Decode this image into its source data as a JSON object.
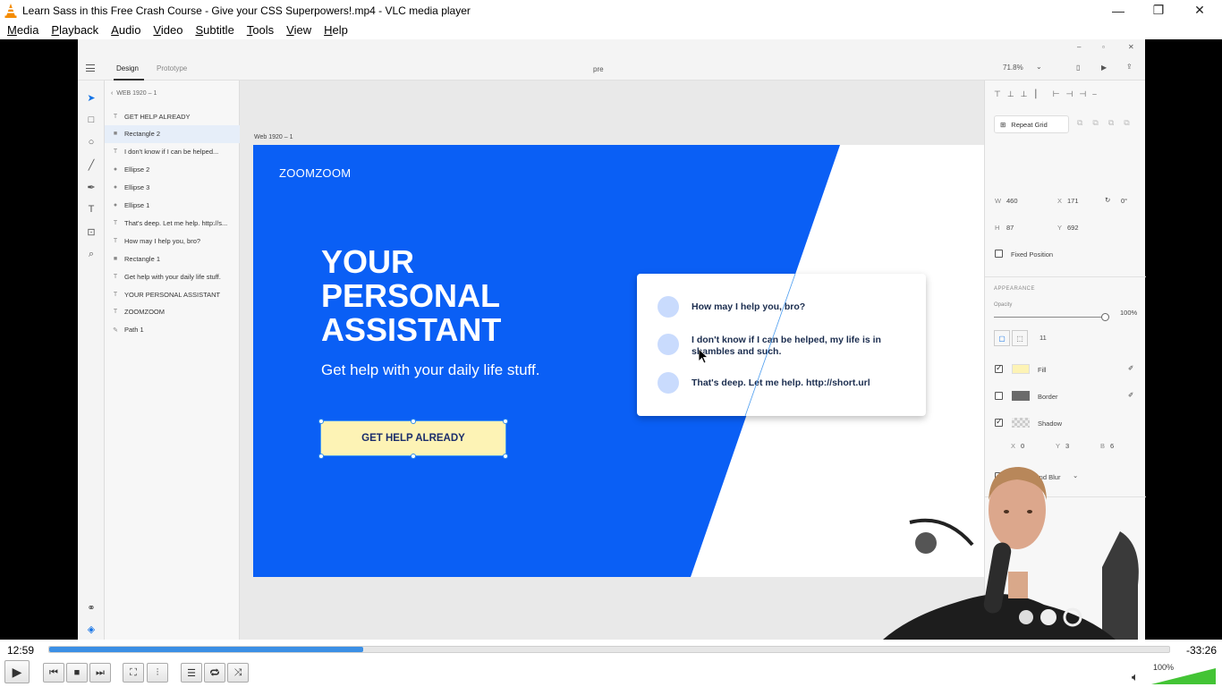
{
  "window": {
    "title": "Learn Sass in this Free Crash Course - Give your CSS Superpowers!.mp4 - VLC media player",
    "minimize_glyph": "—",
    "restore_glyph": "❐",
    "close_glyph": "✕"
  },
  "menu": [
    "Media",
    "Playback",
    "Audio",
    "Video",
    "Subtitle",
    "Tools",
    "View",
    "Help"
  ],
  "xd": {
    "tabs": {
      "design": "Design",
      "prototype": "Prototype"
    },
    "doc_name": "pre",
    "zoom": "71.8%",
    "breadcrumb": "WEB 1920 – 1",
    "artboard_label": "Web 1920 – 1",
    "layers": [
      {
        "icon": "T",
        "label": "GET HELP ALREADY",
        "selected": false
      },
      {
        "icon": "■",
        "label": "Rectangle 2",
        "selected": true
      },
      {
        "icon": "T",
        "label": "I don't know if I can be helped...",
        "selected": false
      },
      {
        "icon": "●",
        "label": "Ellipse 2",
        "selected": false
      },
      {
        "icon": "●",
        "label": "Ellipse 3",
        "selected": false
      },
      {
        "icon": "●",
        "label": "Ellipse 1",
        "selected": false
      },
      {
        "icon": "T",
        "label": "That's deep. Let me help. http://s...",
        "selected": false
      },
      {
        "icon": "T",
        "label": "How may I help you, bro?",
        "selected": false
      },
      {
        "icon": "■",
        "label": "Rectangle 1",
        "selected": false
      },
      {
        "icon": "T",
        "label": "Get help with your daily life stuff.",
        "selected": false
      },
      {
        "icon": "T",
        "label": "YOUR  PERSONAL ASSISTANT",
        "selected": false
      },
      {
        "icon": "T",
        "label": "ZOOMZOOM",
        "selected": false
      },
      {
        "icon": "✎",
        "label": "Path 1",
        "selected": false
      }
    ],
    "design": {
      "brand": "ZOOMZOOM",
      "headline_1": "YOUR",
      "headline_2": "PERSONAL",
      "headline_3": "ASSISTANT",
      "subhead": "Get help with your daily life stuff.",
      "cta": "GET HELP ALREADY",
      "chat": [
        "How may I help you, bro?",
        "I don't know if I can be helped, my life is in shambles and such.",
        "That's deep. Let me help. http://short.url"
      ],
      "blue": "#0a5ff5",
      "cta_bg": "#fdf3b5",
      "cta_text": "#1b2d6b"
    },
    "props": {
      "repeat_grid": "Repeat Grid",
      "w_label": "W",
      "w": "460",
      "x_label": "X",
      "x": "171",
      "rotation": "0°",
      "h_label": "H",
      "h": "87",
      "y_label": "Y",
      "y": "692",
      "fixed_position": "Fixed Position",
      "appearance": "APPEARANCE",
      "opacity_label": "Opacity",
      "opacity": "100%",
      "radius": "11",
      "fill": "Fill",
      "border": "Border",
      "shadow": "Shadow",
      "shadow_x_label": "X",
      "shadow_x": "0",
      "shadow_y_label": "Y",
      "shadow_y": "3",
      "shadow_b_label": "B",
      "shadow_b": "6",
      "background_blur": "Background Blur",
      "fill_color": "#fdf3b5",
      "border_color": "#6b6b6b"
    }
  },
  "player": {
    "elapsed": "12:59",
    "remaining": "-33:26",
    "progress": 0.28,
    "volume_text": "100%",
    "volume": 1.0
  }
}
